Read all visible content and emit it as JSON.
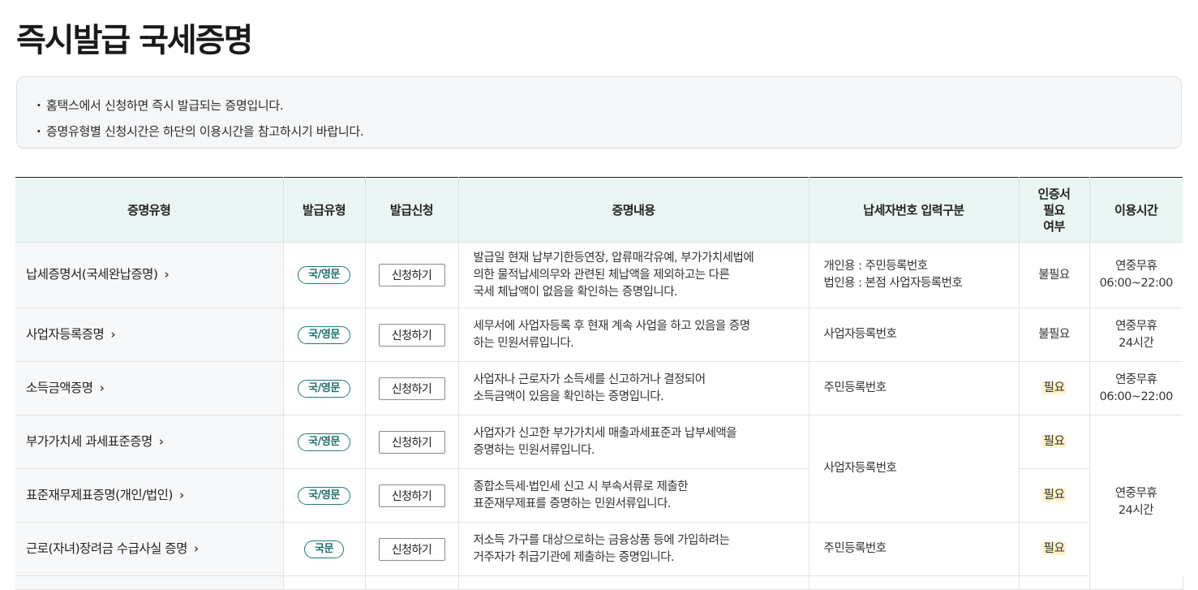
{
  "page": {
    "title": "즉시발급 국세증명"
  },
  "notice": {
    "items": [
      "홈택스에서 신청하면 즉시 발급되는 증명입니다.",
      "증명유형별 신청시간은 하단의 이용시간을 참고하시기 바랍니다."
    ]
  },
  "table": {
    "headers": {
      "type": "증명유형",
      "issue_type": "발급유형",
      "apply": "발급신청",
      "content": "증명내용",
      "input": "납세자번호 입력구분",
      "cert_required_1": "인증서",
      "cert_required_2": "필요",
      "cert_required_3": "여부",
      "hours": "이용시간"
    },
    "rows": [
      {
        "name": "납세증명서(국세완납증명)",
        "badge": "국/영문",
        "apply": "신청하기",
        "desc_1": "발급일 현재 납부기한등연장, 압류매각유예, 부가가치세법에",
        "desc_2": "의한 물적납세의무와 관련된 체납액을 제외하고는 다른",
        "desc_3": "국세 체납액이 없음을 확인하는 증명입니다.",
        "input_1": "개인용 : 주민등록번호",
        "input_2": "법인용 : 본점 사업자등록번호",
        "cert": "불필요",
        "hours_1": "연중무휴",
        "hours_2": "06:00~22:00"
      },
      {
        "name": "사업자등록증명",
        "badge": "국/영문",
        "apply": "신청하기",
        "desc_1": "세무서에 사업자등록 후 현재 계속 사업을 하고 있음을 증명",
        "desc_2": "하는 민원서류입니다.",
        "input_1": "사업자등록번호",
        "cert": "불필요",
        "hours_1": "연중무휴",
        "hours_2": "24시간"
      },
      {
        "name": "소득금액증명",
        "badge": "국/영문",
        "apply": "신청하기",
        "desc_1": "사업자나 근로자가 소득세를 신고하거나 결정되어",
        "desc_2": "소득금액이 있음을 확인하는 증명입니다.",
        "input_1": "주민등록번호",
        "cert": "필요",
        "hours_1": "연중무휴",
        "hours_2": "06:00~22:00"
      },
      {
        "name": "부가가치세 과세표준증명",
        "badge": "국/영문",
        "apply": "신청하기",
        "desc_1": "사업자가 신고한 부가가치세 매출과세표준과 납부세액을",
        "desc_2": "증명하는 민원서류입니다.",
        "input_1": "사업자등록번호",
        "cert": "필요",
        "hours_1": "연중무휴",
        "hours_2": "24시간"
      },
      {
        "name": "표준재무제표증명(개인/법인)",
        "badge": "국/영문",
        "apply": "신청하기",
        "desc_1": "종합소득세·법인세 신고 시 부속서류로 제출한",
        "desc_2": "표준재무제표를 증명하는 민원서류입니다.",
        "cert": "필요"
      },
      {
        "name": "근로(자녀)장려금 수급사실 증명",
        "badge": "국문",
        "apply": "신청하기",
        "desc_1": "저소득 가구를 대상으로하는 금융상품 등에 가입하려는",
        "desc_2": "거주자가 취급기관에 제출하는 증명입니다.",
        "input_1": "주민등록번호",
        "cert": "필요"
      }
    ]
  },
  "colors": {
    "header_bg": "#eaf6f4",
    "badge": "#1b7d78",
    "highlight": "#fff3c9"
  }
}
